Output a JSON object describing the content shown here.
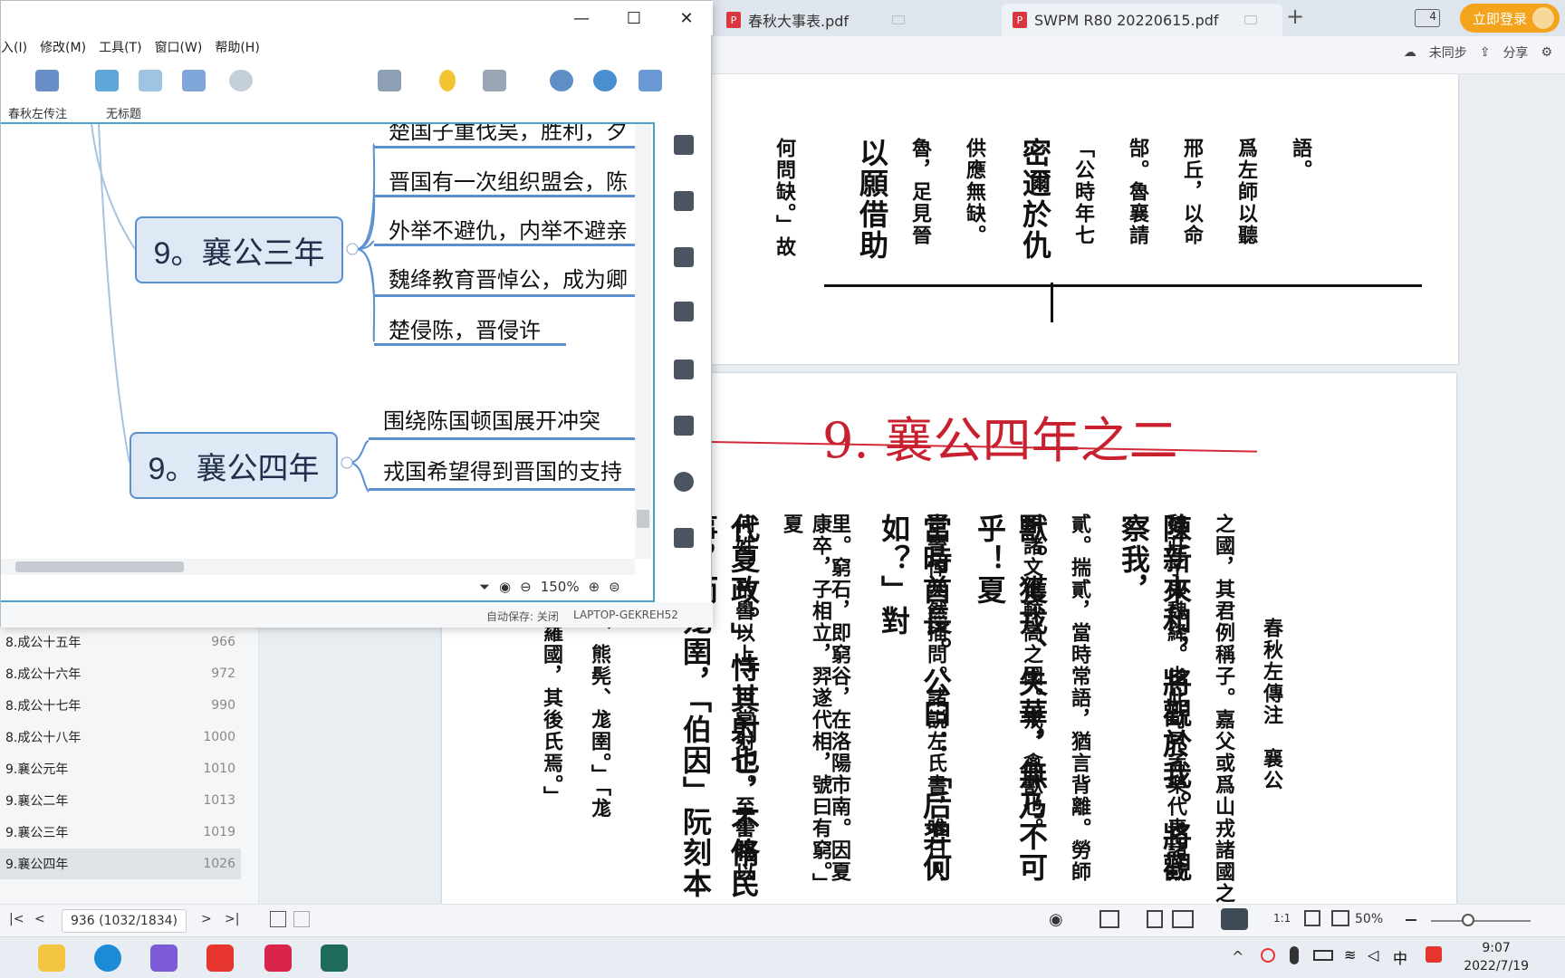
{
  "pdf_tabs": [
    {
      "label": "春秋大事表.pdf"
    },
    {
      "label": "SWPM R80 20220615.pdf"
    }
  ],
  "pdf_header": {
    "new_tab": "+",
    "page_count_badge": "4",
    "login_label": "立即登录",
    "sync_label": "未同步",
    "share_label": "分享"
  },
  "xmind": {
    "menu": [
      "入(I)",
      "修改(M)",
      "工具(T)",
      "窗口(W)",
      "帮助(H)"
    ],
    "window_controls": {
      "minimize": "—",
      "maximize": "☐",
      "close": "✕"
    },
    "sheet_tabs": [
      "春秋左传注",
      "无标题"
    ],
    "topics": [
      {
        "label": "9。襄公三年",
        "subtopics": [
          "楚国子重伐吴，胜利，夕",
          "晋国有一次组织盟会，陈",
          "外举不避仇，内举不避亲",
          "魏绛教育晋悼公，成为卿",
          "楚侵陈，晋侵许"
        ]
      },
      {
        "label": "9。襄公四年",
        "subtopics": [
          "围绕陈国顿国展开冲突",
          "戎国希望得到晋国的支持"
        ]
      }
    ],
    "zoom": "150%",
    "status": {
      "autosave": "自动保存: 关闭",
      "device": "LAPTOP-GEKREH52"
    }
  },
  "toc": [
    {
      "label": "8.成公十五年",
      "page": "966"
    },
    {
      "label": "8.成公十六年",
      "page": "972"
    },
    {
      "label": "8.成公十七年",
      "page": "990"
    },
    {
      "label": "8.成公十八年",
      "page": "1000"
    },
    {
      "label": "9.襄公元年",
      "page": "1010"
    },
    {
      "label": "9.襄公二年",
      "page": "1013"
    },
    {
      "label": "9.襄公三年",
      "page": "1019"
    },
    {
      "label": "9.襄公四年",
      "page": "1026",
      "active": true
    }
  ],
  "pdf_page": {
    "heading": "9. 襄公四年之二",
    "upper_columns": [
      "何問缺。」故",
      "以願借助",
      "魯，足見晉",
      "供應無缺。",
      "密邇於仇",
      "「公時年七",
      "郜。魯襄請",
      "邢丘，以命",
      "爲左師以聽",
      "語。"
    ],
    "lower_columns": [
      "春秋左傳注　襄公",
      "之國，其君例稱子。嘉父或爲山戎諸國之",
      "魏莊子即魏絳。由此可見孟樂代表諸戎",
      "陳新來和，將觀於我。將觀察我，",
      "貳。揣貳，當時常語，猶言背離。勞師",
      "原諸文化較高之國。戎，禽獸也。",
      "獸。獲戎、失華，無乃不可乎！夏",
      "是晉悼突然插問。諸説左氏書，唯日人",
      "當時酋長。公曰：「后羿何如？」對",
      "里。窮石，即窮谷，在洛陽市南。因夏",
      "康卒，子相立，羿遂代相，號曰有窮。」夏",
      "何姓。帝嚳以上，世掌射正。至嚳賜以",
      "代夏政。」恃其射也，不脩民事，而",
      "熊髡、尨圉，「伯因」阮刻本作",
      "武羅、伯姻、熊髡、尨圉。」「尨",
      "「夏時有武羅國，其後氏焉。」"
    ]
  },
  "pdf_status": {
    "page_input": "936 (1032/1834)",
    "zoom": "50%"
  },
  "taskbar": {
    "time": "9:07",
    "date": "2022/7/19"
  }
}
